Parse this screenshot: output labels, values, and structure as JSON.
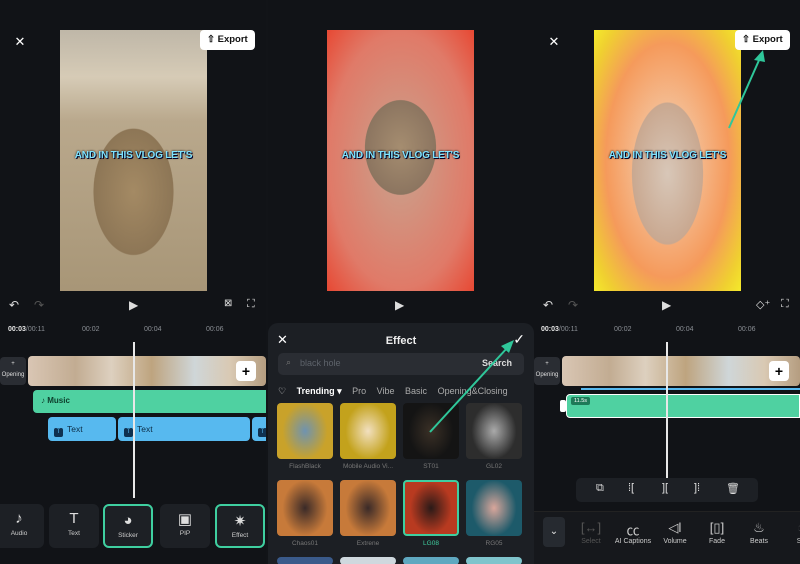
{
  "caption": "AND IN THIS VLOG LET'S",
  "export_label": "Export",
  "timeline": {
    "current": "00:03",
    "total": "/00:11",
    "ticks": [
      "00:02",
      "00:04",
      "00:06"
    ],
    "opening_label": "Opening"
  },
  "tracks": {
    "music_label": "Music",
    "text_clips": [
      "Text",
      "Text"
    ],
    "audio_duration": "11.5s"
  },
  "toolbar": [
    {
      "label": "Audio",
      "icon": "♪"
    },
    {
      "label": "Text",
      "icon": "T"
    },
    {
      "label": "Sticker",
      "icon": "◕"
    },
    {
      "label": "PIP",
      "icon": "▣"
    },
    {
      "label": "Effect",
      "icon": "✷"
    }
  ],
  "effect_sheet": {
    "title": "Effect",
    "search_placeholder": "black hole",
    "search_button": "Search",
    "categories": [
      "Trending ▾",
      "Pro",
      "Vibe",
      "Basic",
      "Opening&Closing"
    ],
    "items": [
      {
        "label": "FlashBlack",
        "colors": [
          "#c9a22a",
          "#6f93b0"
        ]
      },
      {
        "label": "Mobile Audio Vi...",
        "colors": [
          "#c3a21c",
          "#f2e0c0"
        ]
      },
      {
        "label": "ST01",
        "colors": [
          "#141414",
          "#3a3026"
        ]
      },
      {
        "label": "GL02",
        "colors": [
          "#2d2d2d",
          "#aaaaaa"
        ]
      },
      {
        "label": "Chaos01",
        "colors": [
          "#c77a3a",
          "#3a2a28"
        ]
      },
      {
        "label": "Extrene",
        "colors": [
          "#c77a3a",
          "#3a2a28"
        ]
      },
      {
        "label": "LG08",
        "colors": [
          "#b83a20",
          "#2a1a18"
        ],
        "selected": true
      },
      {
        "label": "RG05",
        "colors": [
          "#1d5a6a",
          "#d9a69b"
        ]
      }
    ]
  },
  "audio_actions": [
    {
      "label": "Select",
      "icon": "[↔]"
    },
    {
      "label": "AI Captions",
      "icon": "㏄"
    },
    {
      "label": "Volume",
      "icon": "◁ǀ"
    },
    {
      "label": "Fade",
      "icon": "[▯]"
    },
    {
      "label": "Beats",
      "icon": "♨"
    },
    {
      "label": "Sp",
      "icon": "◔"
    }
  ],
  "accent": "#3fcfa0"
}
